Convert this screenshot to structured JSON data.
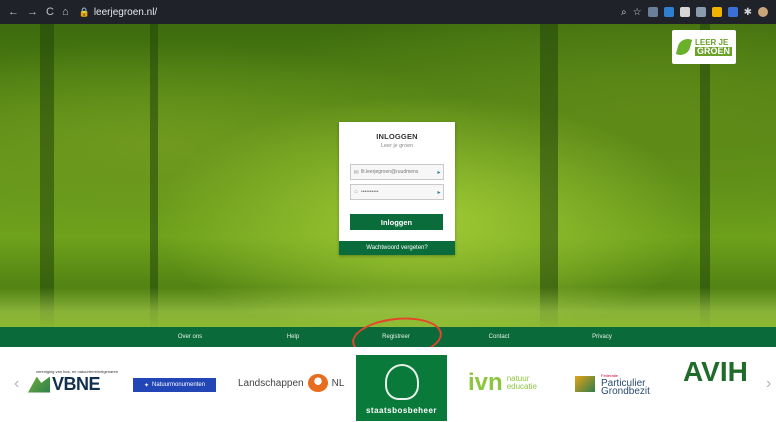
{
  "browser": {
    "url": "leerjegroen.nl/",
    "nav_back": "←",
    "nav_forward": "→",
    "nav_reload": "C",
    "nav_home": "⌂",
    "icons": [
      "search-icon",
      "star-icon",
      "extension-icon",
      "extension-icon",
      "shield-icon",
      "extension-icon",
      "puzzle-icon",
      "profile-avatar"
    ]
  },
  "badge": {
    "line1": "LEER JE",
    "line2": "GROEN"
  },
  "login": {
    "title": "INLOGGEN",
    "subtitle": "Leer je groen",
    "email_value": "llt.leerjegroen@ruudmens",
    "password_value": "••••••••••",
    "submit_label": "Inloggen",
    "forgot_label": "Wachtwoord vergeten?"
  },
  "footer_nav": [
    {
      "label": "Over ons"
    },
    {
      "label": "Help"
    },
    {
      "label": "Registreer"
    },
    {
      "label": "Contact"
    },
    {
      "label": "Privacy"
    }
  ],
  "partners": {
    "vbne_small": "vereniging van bos- en natuurterreineigenaren",
    "vbne": "VBNE",
    "natuurmonumenten": "Natuurmonumenten",
    "landschappen": "Landschappen",
    "landschappen_nl": "NL",
    "staatsbosbeheer": "staatsbosbeheer",
    "ivn": "ivn",
    "ivn_sub1": "natuur",
    "ivn_sub2": "educatie",
    "federatie_small": "Federatie",
    "federatie_1": "Particulier",
    "federatie_2": "Grondbezit",
    "avih": "AVIH",
    "prev": "‹",
    "next": "›"
  },
  "colors": {
    "brand_green": "#0a6b3b",
    "annotation_red": "#e4462a"
  }
}
